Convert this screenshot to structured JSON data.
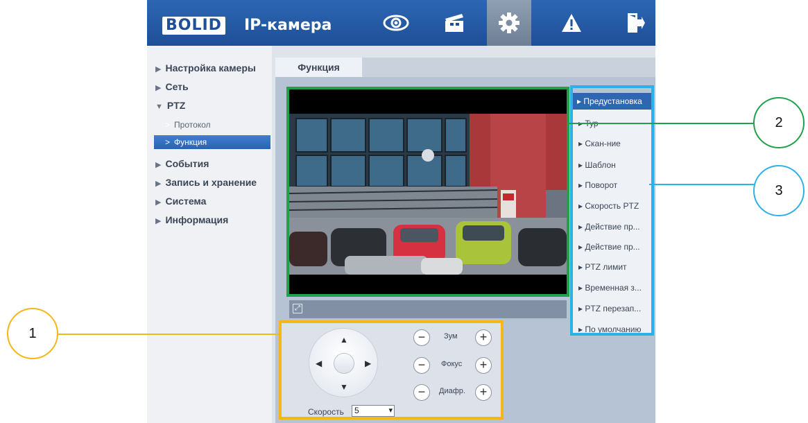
{
  "header": {
    "logo_text": "BOLID",
    "title": "IP-камера",
    "nav_icons": [
      "eye-icon",
      "clapperboard-icon",
      "gear-icon",
      "warning-icon",
      "logout-icon"
    ],
    "active_nav": "gear-icon"
  },
  "sidebar": {
    "items": [
      {
        "label": "Настройка камеры",
        "expanded": false
      },
      {
        "label": "Сеть",
        "expanded": false
      },
      {
        "label": "PTZ",
        "expanded": true
      },
      {
        "label": "События",
        "expanded": false
      },
      {
        "label": "Запись и хранение",
        "expanded": false
      },
      {
        "label": "Система",
        "expanded": false
      },
      {
        "label": "Информация",
        "expanded": false
      }
    ],
    "ptz_sub": [
      {
        "label": "Протокол",
        "active": false
      },
      {
        "label": "Функция",
        "active": true
      }
    ]
  },
  "tab": {
    "label": "Функция"
  },
  "ptz_menu": {
    "items": [
      "Предустановка",
      "Тур",
      "Скан-ние",
      "Шаблон",
      "Поворот",
      "Скорость PTZ",
      "Действие пр...",
      "Действие пр...",
      "PTZ лимит",
      "Временная з...",
      "PTZ перезап...",
      "По умолчанию"
    ],
    "active_index": 0
  },
  "ptz_controls": {
    "zoom_label": "Зум",
    "focus_label": "Фокус",
    "iris_label": "Диафр.",
    "speed_label": "Скорость",
    "speed_value": "5"
  },
  "callouts": {
    "one": "1",
    "two": "2",
    "three": "3"
  },
  "colors": {
    "header": "#2559a6",
    "active_item": "#2f66b2",
    "callout_1": "#f4b716",
    "callout_2": "#1fa04a",
    "callout_3": "#2bb1ea"
  }
}
